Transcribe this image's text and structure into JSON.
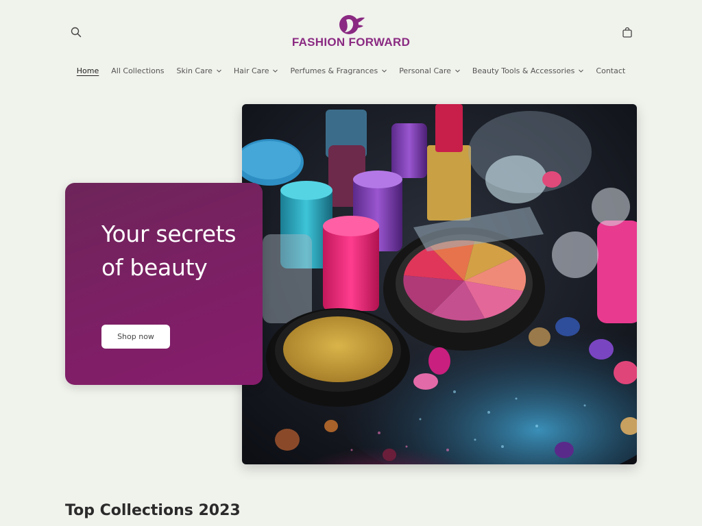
{
  "header": {
    "logo_text": "FASHION FORWARD",
    "search_icon": "search-icon",
    "cart_icon": "shopping-bag-icon"
  },
  "nav": {
    "items": [
      {
        "label": "Home",
        "active": true,
        "dropdown": false
      },
      {
        "label": "All Collections",
        "dropdown": false
      },
      {
        "label": "Skin Care",
        "dropdown": true
      },
      {
        "label": "Hair Care",
        "dropdown": true
      },
      {
        "label": "Perfumes & Fragrances",
        "dropdown": true
      },
      {
        "label": "Personal Care",
        "dropdown": true
      },
      {
        "label": "Beauty Tools & Accessories",
        "dropdown": true
      },
      {
        "label": "Contact",
        "dropdown": false
      }
    ]
  },
  "hero": {
    "heading": "Your secrets of beauty",
    "button_label": "Shop now"
  },
  "section": {
    "title": "Top Collections 2023"
  },
  "colors": {
    "brand": "#8a2a82",
    "hero_card": "#7e1f66",
    "background": "#f0f2ec"
  }
}
